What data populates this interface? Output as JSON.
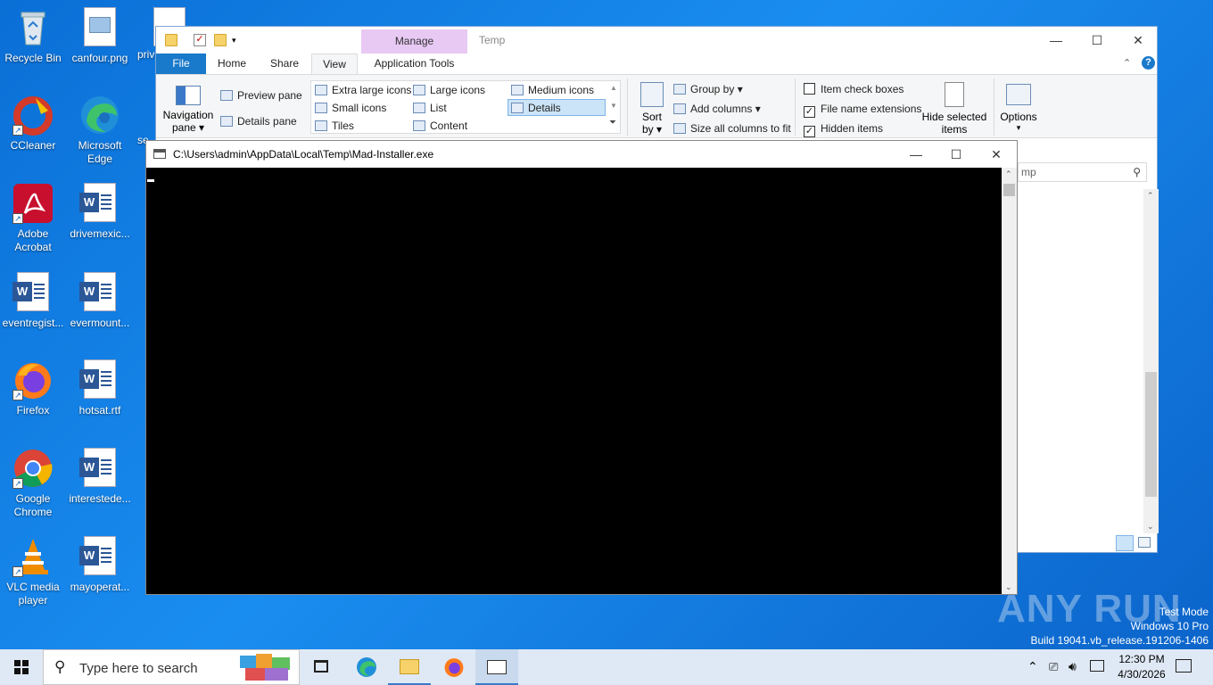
{
  "desktop": {
    "icons": [
      {
        "label": "Recycle Bin"
      },
      {
        "label": "canfour.png"
      },
      {
        "label": "priv"
      },
      {
        "label": "CCleaner"
      },
      {
        "label": "Microsoft Edge"
      },
      {
        "label": "se"
      },
      {
        "label": "Adobe Acrobat"
      },
      {
        "label": "drivemexic..."
      },
      {
        "label": "eventregist..."
      },
      {
        "label": "evermount..."
      },
      {
        "label": "Firefox"
      },
      {
        "label": "hotsat.rtf"
      },
      {
        "label": "Google Chrome"
      },
      {
        "label": "interestede..."
      },
      {
        "label": "VLC media player"
      },
      {
        "label": "mayoperat..."
      }
    ]
  },
  "explorer": {
    "title": "Temp",
    "manage_label": "Manage",
    "tabs": {
      "file": "File",
      "home": "Home",
      "share": "Share",
      "view": "View",
      "app_tools": "Application Tools"
    },
    "ribbon": {
      "navigation_pane": "Navigation",
      "navigation_pane_2": "pane",
      "preview_pane": "Preview pane",
      "details_pane": "Details pane",
      "layout": {
        "extra_large": "Extra large icons",
        "large": "Large icons",
        "medium": "Medium icons",
        "small": "Small icons",
        "list": "List",
        "details": "Details",
        "tiles": "Tiles",
        "content": "Content"
      },
      "sort_by": "Sort",
      "sort_by_2": "by",
      "group_by": "Group by",
      "add_columns": "Add columns",
      "size_columns": "Size all columns to fit",
      "item_check_boxes": "Item check boxes",
      "file_name_extensions": "File name extensions",
      "hidden_items": "Hidden items",
      "hide_selected": "Hide selected",
      "hide_selected_2": "items",
      "options": "Options"
    },
    "checks": {
      "item_check_boxes": false,
      "file_name_extensions": true,
      "hidden_items": true
    },
    "search_text": "mp"
  },
  "console": {
    "title": "C:\\Users\\admin\\AppData\\Local\\Temp\\Mad-Installer.exe"
  },
  "watermark": {
    "brand": "ANY RUN",
    "line1": "Test Mode",
    "line2": "Windows 10 Pro",
    "line3": "Build 19041.vb_release.191206-1406"
  },
  "taskbar": {
    "search_placeholder": "Type here to search",
    "time": "12:30 PM",
    "date": "4/30/2026"
  },
  "colors": {
    "accent": "#1979ca",
    "desktop": "#1a8df0",
    "manage": "#e8c9f4"
  }
}
